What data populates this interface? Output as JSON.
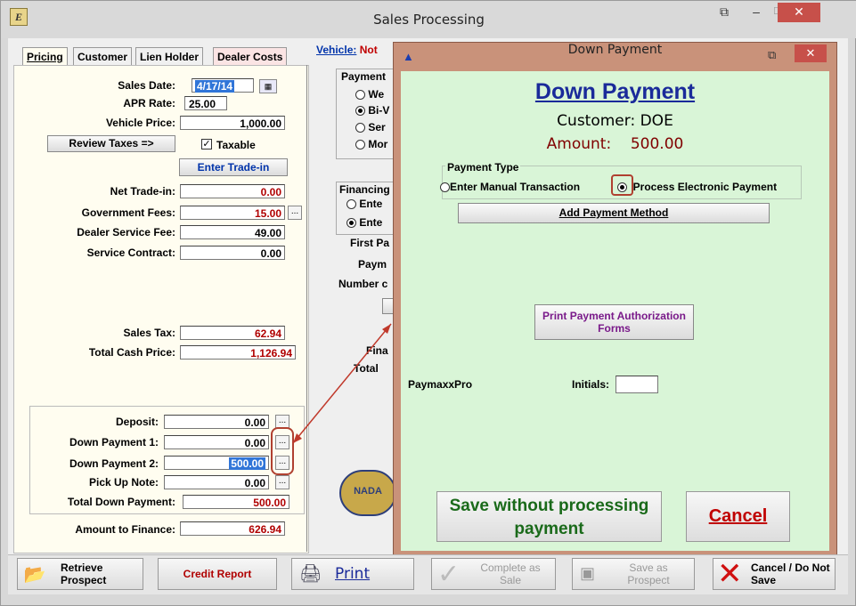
{
  "window": {
    "title": "Sales Processing"
  },
  "tabs": [
    "Pricing",
    "Customer",
    "Lien Holder",
    "Dealer Costs"
  ],
  "vehicle": {
    "label": "Vehicle:",
    "value": "Not"
  },
  "pricing": {
    "sales_date_label": "Sales Date:",
    "sales_date": "4/17/14",
    "apr_label": "APR Rate:",
    "apr": "25.00",
    "vehicle_price_label": "Vehicle Price:",
    "vehicle_price": "1,000.00",
    "review_taxes": "Review Taxes =>",
    "taxable_label": "Taxable",
    "enter_tradein": "Enter Trade-in",
    "net_tradein_label": "Net Trade-in:",
    "net_tradein": "0.00",
    "gov_fees_label": "Government Fees:",
    "gov_fees": "15.00",
    "dealer_fee_label": "Dealer Service Fee:",
    "dealer_fee": "49.00",
    "service_contract_label": "Service Contract:",
    "service_contract": "0.00",
    "sales_tax_label": "Sales Tax:",
    "sales_tax": "62.94",
    "total_cash_label": "Total Cash Price:",
    "total_cash": "1,126.94",
    "deposit_label": "Deposit:",
    "deposit": "0.00",
    "dp1_label": "Down Payment 1:",
    "dp1": "0.00",
    "dp2_label": "Down Payment 2:",
    "dp2": "500.00",
    "pickup_label": "Pick Up Note:",
    "pickup": "0.00",
    "total_dp_label": "Total Down Payment:",
    "total_dp": "500.00",
    "amount_finance_label": "Amount to Finance:",
    "amount_finance": "626.94"
  },
  "payment_partial": {
    "heading": "Payment",
    "options": [
      "We",
      "Bi-V",
      "Ser",
      "Mor"
    ],
    "financing": "Financing",
    "fin_options": [
      "Ente",
      "Ente"
    ],
    "labels": [
      "First Pa",
      "Paym",
      "Number c",
      "Fina",
      "Total"
    ]
  },
  "dialog": {
    "title": "Down Payment",
    "heading": "Down Payment",
    "customer_label": "Customer:",
    "customer": "DOE",
    "amount_label": "Amount:",
    "amount": "500.00",
    "payment_type_label": "Payment Type",
    "opt_manual": "Enter Manual Transaction",
    "opt_electronic": "Process Electronic Payment",
    "add_method": "Add Payment Method",
    "print_forms": "Print Payment Authorization Forms",
    "paymaxx": "PaymaxxPro",
    "initials_label": "Initials:",
    "save_btn": "Save without processing payment",
    "cancel_btn": "Cancel"
  },
  "bottom": {
    "retrieve": "Retrieve Prospect",
    "credit": "Credit Report",
    "print": "Print",
    "complete": "Complete as Sale",
    "save_prospect": "Save as Prospect",
    "cancel": "Cancel / Do Not Save"
  },
  "nada": "NADA",
  "colors": {
    "dialog_bg": "#d9f5d7",
    "dialog_frame": "#c9927a",
    "accent_red": "#b00000",
    "link_blue": "#0033aa"
  }
}
